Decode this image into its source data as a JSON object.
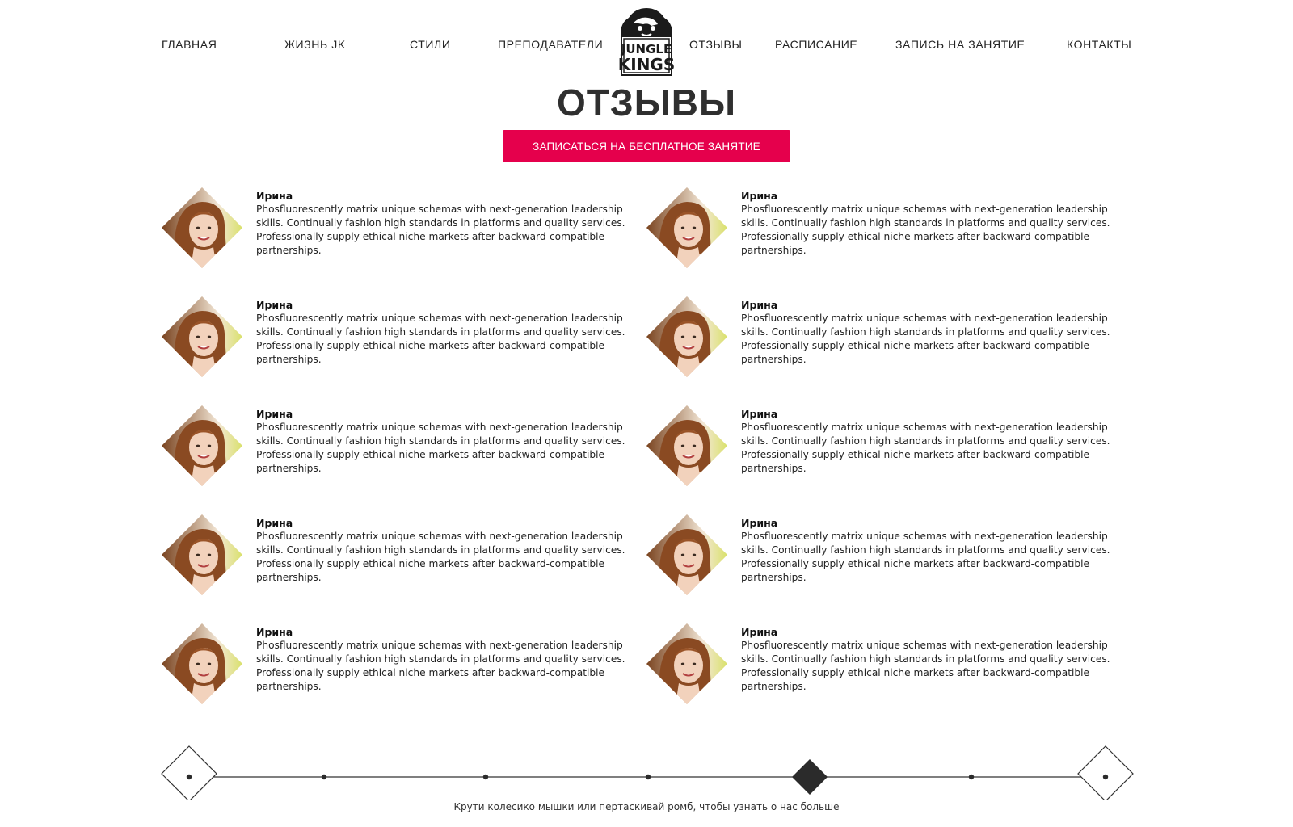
{
  "nav": {
    "items": [
      {
        "label": "ГЛАВНАЯ"
      },
      {
        "label": "ЖИЗНЬ JK"
      },
      {
        "label": "СТИЛИ"
      },
      {
        "label": "ПРЕПОДАВАТЕЛИ"
      },
      {
        "label": "ОТЗЫВЫ"
      },
      {
        "label": "РАСПИСАНИЕ"
      },
      {
        "label": "ЗАПИСЬ НА ЗАНЯТИЕ"
      },
      {
        "label": "КОНТАКТЫ"
      }
    ],
    "logo": {
      "line1": "JUNGLE",
      "line2": "KINGS",
      "icon": "gorilla-logo-icon"
    }
  },
  "page": {
    "title": "ОТЗЫВЫ",
    "cta_label": "ЗАПИСАТЬСЯ НА БЕСПЛАТНОЕ ЗАНЯТИЕ"
  },
  "reviews": [
    {
      "name": "Ирина",
      "text": "Phosfluorescently matrix unique schemas with next-generation leadership skills. Continually fashion high standards in platforms and quality services. Professionally supply ethical niche markets after backward-compatible partnerships."
    },
    {
      "name": "Ирина",
      "text": "Phosfluorescently matrix unique schemas with next-generation leadership skills. Continually fashion high standards in platforms and quality services. Professionally supply ethical niche markets after backward-compatible partnerships."
    },
    {
      "name": "Ирина",
      "text": "Phosfluorescently matrix unique schemas with next-generation leadership skills. Continually fashion high standards in platforms and quality services. Professionally supply ethical niche markets after backward-compatible partnerships."
    },
    {
      "name": "Ирина",
      "text": "Phosfluorescently matrix unique schemas with next-generation leadership skills. Continually fashion high standards in platforms and quality services. Professionally supply ethical niche markets after backward-compatible partnerships."
    },
    {
      "name": "Ирина",
      "text": "Phosfluorescently matrix unique schemas with next-generation leadership skills. Continually fashion high standards in platforms and quality services. Professionally supply ethical niche markets after backward-compatible partnerships."
    },
    {
      "name": "Ирина",
      "text": "Phosfluorescently matrix unique schemas with next-generation leadership skills. Continually fashion high standards in platforms and quality services. Professionally supply ethical niche markets after backward-compatible partnerships."
    },
    {
      "name": "Ирина",
      "text": "Phosfluorescently matrix unique schemas with next-generation leadership skills. Continually fashion high standards in platforms and quality services. Professionally supply ethical niche markets after backward-compatible partnerships."
    },
    {
      "name": "Ирина",
      "text": "Phosfluorescently matrix unique schemas with next-generation leadership skills. Continually fashion high standards in platforms and quality services. Professionally supply ethical niche markets after backward-compatible partnerships."
    },
    {
      "name": "Ирина",
      "text": "Phosfluorescently matrix unique schemas with next-generation leadership skills. Continually fashion high standards in platforms and quality services. Professionally supply ethical niche markets after backward-compatible partnerships."
    },
    {
      "name": "Ирина",
      "text": "Phosfluorescently matrix unique schemas with next-generation leadership skills. Continually fashion high standards in platforms and quality services. Professionally supply ethical niche markets after backward-compatible partnerships."
    }
  ],
  "timeline": {
    "stops": 7,
    "active_index": 4,
    "hint": "Крути колесико мышки или пертаскивай ромб, чтобы узнать о нас больше"
  },
  "colors": {
    "accent": "#e5004c",
    "text": "#222222",
    "title": "#2f2f2f",
    "background": "#ffffff"
  }
}
